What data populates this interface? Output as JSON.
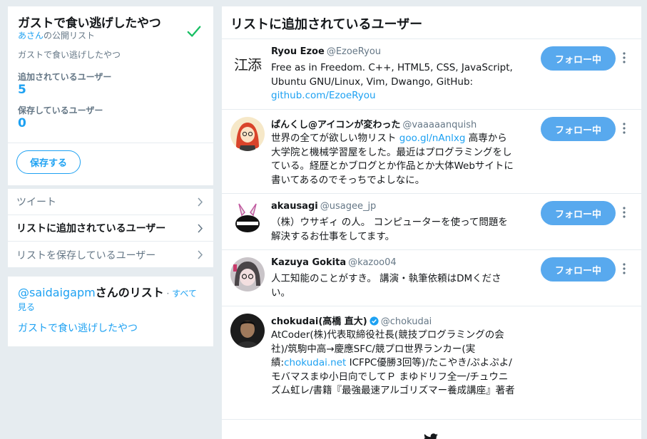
{
  "list_card": {
    "title": "ガストで食い逃げしたやつ",
    "owner_link": "あさん",
    "owner_suffix": "の公開リスト",
    "description": "ガストで食い逃げしたやつ",
    "members_label": "追加されているユーザー",
    "members_count": "5",
    "subscribers_label": "保存しているユーザー",
    "subscribers_count": "0",
    "save_label": "保存する",
    "check_icon": "check-icon",
    "accent_color": "#1da1f2"
  },
  "nav": {
    "items": [
      {
        "label": "ツイート"
      },
      {
        "label": "リストに追加されているユーザー"
      },
      {
        "label": "リストを保存しているユーザー"
      }
    ]
  },
  "other_lists": {
    "handle": "@saidaigapm",
    "suffix": "さんのリスト",
    "separator": " · ",
    "see_all": "すべて見る",
    "items": [
      {
        "label": "ガストで食い逃げしたやつ"
      }
    ]
  },
  "main": {
    "title": "リストに追加されているユーザー",
    "users": [
      {
        "name": "Ryou Ezoe",
        "handle": "@EzoeRyou",
        "avatar_text": "江添",
        "bio_parts": [
          "Free as in Freedom. C++, HTML5, CSS, JavaScript, Ubuntu GNU/Linux, Vim, Dwango, GitHub: ",
          "github.com/EzoeRyou",
          ""
        ],
        "follow_label": "フォロー中"
      },
      {
        "name": "ぱんくし@アイコンが変わった",
        "handle": "@vaaaaanquish",
        "bio_parts": [
          "世界の全てが欲しい物リスト ",
          "goo.gl/nAnlxg",
          " 高専から大学院と機械学習屋をした。最近はプログラミングをしている。経歴とかブログとか作品とか大体Webサイトに書いてあるのでそっちでよしなに。"
        ],
        "follow_label": "フォロー中"
      },
      {
        "name": "akausagi",
        "handle": "@usagee_jp",
        "bio_parts": [
          "（株）ウサギィ の人。 コンピューターを使って問題を解決するお仕事をしてます。",
          "",
          ""
        ],
        "follow_label": "フォロー中"
      },
      {
        "name": "Kazuya Gokita",
        "handle": "@kazoo04",
        "bio_parts": [
          "人工知能のことがすき。 講演・執筆依頼はDMください。",
          "",
          ""
        ],
        "follow_label": "フォロー中"
      },
      {
        "name": "chokudai(高橋 直大)",
        "handle": "@chokudai",
        "verified": true,
        "bio_parts": [
          "AtCoder(株)代表取締役社長(競技プログラミングの会社)/筑駒中高→慶應SFC/競プロ世界ランカー(実績:",
          "chokudai.net",
          " ICFPC優勝3回等)/たこやき/ぷよぷよ/モバマスまゆ小日向でしてＰ まゆドリフ全一/チュウニズム虹レ/書籍『最強最速アルゴリズマー養成講座』著者"
        ],
        "follow_label": ""
      }
    ],
    "footer_icon": "bird-icon"
  }
}
